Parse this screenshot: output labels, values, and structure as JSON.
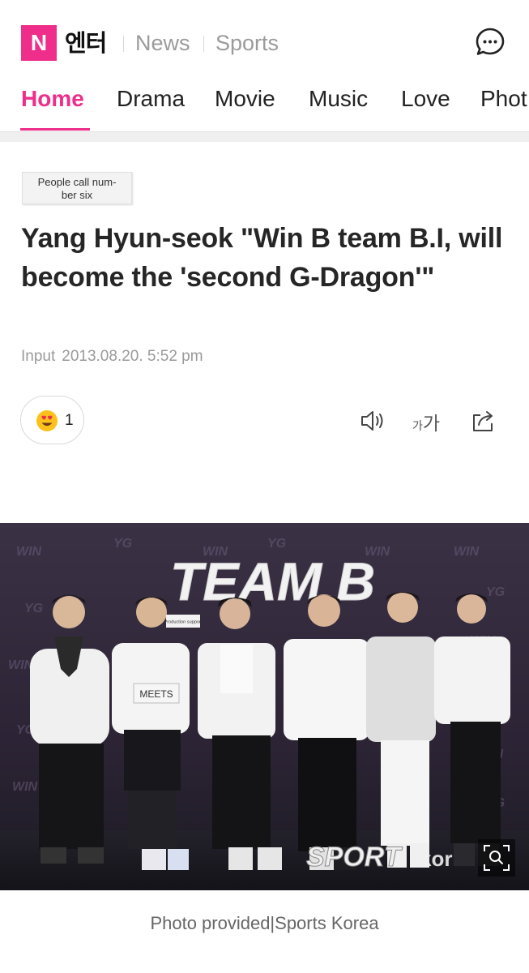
{
  "header": {
    "logo_letter": "N",
    "logo_text": "엔터",
    "links": [
      "News",
      "Sports"
    ],
    "chat_icon": "chat-bubble-icon"
  },
  "tabs": [
    {
      "label": "Home",
      "active": true
    },
    {
      "label": "Drama",
      "active": false
    },
    {
      "label": "Movie",
      "active": false
    },
    {
      "label": "Music",
      "active": false
    },
    {
      "label": "Love",
      "active": false
    },
    {
      "label": "Phot",
      "active": false
    }
  ],
  "article": {
    "category": "People call num-\nber six",
    "headline": "Yang Hyun-seok \"Win B team B.I, will become the 'second G-Dragon'\"",
    "input_label": "Input",
    "input_time": "2013.08.20. 5:52 pm",
    "reaction_count": "1",
    "font_size_small": "가",
    "font_size_big": "가"
  },
  "photo": {
    "banner_text": "TEAM B",
    "badge_small": "Production support",
    "badge_meets": "MEETS",
    "watermark": "SPORT",
    "watermark_sub": "kor",
    "caption": "Photo provided|Sports Korea"
  },
  "colors": {
    "accent": "#ee2e8a",
    "text": "#262626",
    "muted": "#9a9a9a"
  }
}
